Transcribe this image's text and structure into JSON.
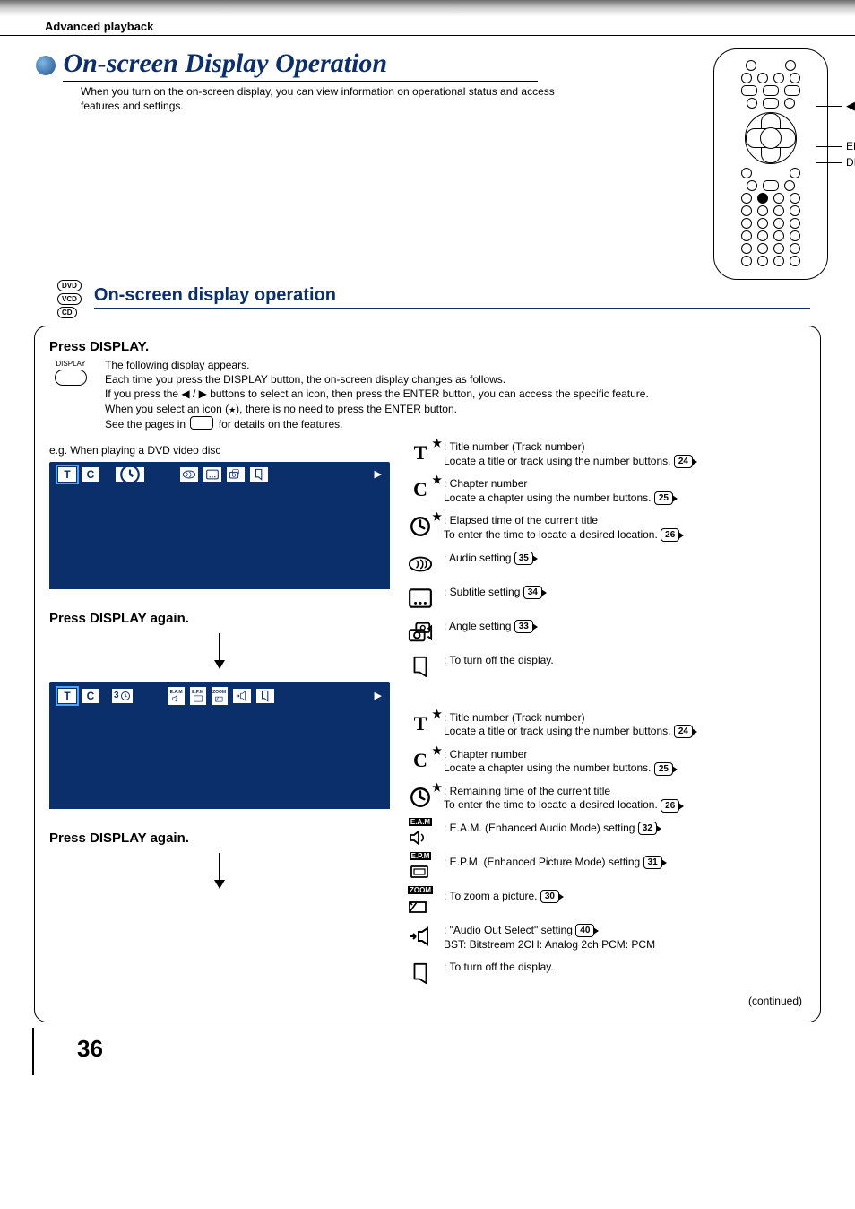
{
  "section": "Advanced playback",
  "title": "On-screen Display Operation",
  "intro": "When you turn on the on-screen display, you can view information on operational status and access features and settings.",
  "remote": {
    "arrows": "◀ / ▶",
    "enter": "ENTER",
    "display": "DISPLAY"
  },
  "badges": [
    "DVD",
    "VCD",
    "CD"
  ],
  "subTitle": "On-screen display operation",
  "step1": {
    "heading": "Press DISPLAY.",
    "btn": "DISPLAY",
    "p1": "The following display appears.",
    "p2": "Each time you press the DISPLAY button, the on-screen display changes as follows.",
    "p3a": "If you press the ",
    "p3arrows": "◀ / ▶",
    "p3b": " buttons to select an icon, then press the ENTER button, you can access the specific feature.",
    "p4a": "When you select an icon (",
    "p4b": "), there is no need to press the ENTER button.",
    "p5a": "See the pages in ",
    "p5b": " for details on the features."
  },
  "exampleLabel": "e.g. When playing a DVD video disc",
  "pressAgain": "Press DISPLAY again.",
  "osd": {
    "t": "T",
    "c": "C",
    "three": "3",
    "play": "▶"
  },
  "legend1": [
    {
      "icon": "T",
      "star": true,
      "t1": ": Title number (Track number)",
      "t2": "Locate a title or track using the number buttons.",
      "ref": "24"
    },
    {
      "icon": "C",
      "star": true,
      "t1": ": Chapter number",
      "t2": "Locate a chapter using the number buttons.",
      "ref": "25"
    },
    {
      "icon": "clock",
      "star": true,
      "t1": ": Elapsed time of the current title",
      "t2": "To enter the time to locate a desired location.",
      "ref": "26"
    },
    {
      "icon": "audio",
      "t1": ": Audio setting",
      "ref": "35"
    },
    {
      "icon": "subtitle",
      "t1": ": Subtitle setting",
      "ref": "34"
    },
    {
      "icon": "angle",
      "t1": ": Angle setting",
      "ref": "33"
    },
    {
      "icon": "off",
      "t1": ": To turn off the display."
    }
  ],
  "legend2": [
    {
      "icon": "T",
      "star": true,
      "t1": ": Title number (Track number)",
      "t2": "Locate a title or track using the number buttons.",
      "ref": "24"
    },
    {
      "icon": "C",
      "star": true,
      "t1": ": Chapter number",
      "t2": "Locate a chapter using the number buttons.",
      "ref": "25"
    },
    {
      "icon": "clock",
      "star": true,
      "t1": ": Remaining time of the current title",
      "t2": "To enter the time to locate a desired location.",
      "ref": "26"
    },
    {
      "icon": "eam",
      "t1": ": E.A.M. (Enhanced Audio Mode) setting",
      "ref": "32"
    },
    {
      "icon": "epm",
      "t1": ": E.P.M. (Enhanced Picture Mode) setting",
      "ref": "31"
    },
    {
      "icon": "zoom",
      "t1": ": To zoom a picture.",
      "ref": "30"
    },
    {
      "icon": "aout",
      "t1": ": \"Audio Out Select\" setting",
      "ref": "40",
      "t2": "BST: Bitstream    2CH: Analog 2ch    PCM: PCM"
    },
    {
      "icon": "off",
      "t1": ": To turn off the display."
    }
  ],
  "continued": "(continued)",
  "pageNumber": "36",
  "starGlyph": "★",
  "eam": "E.A.M",
  "epm": "E.P.M",
  "zoom": "ZOOM"
}
